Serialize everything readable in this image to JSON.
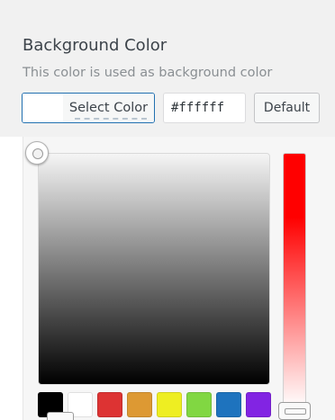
{
  "control": {
    "title": "Background Color",
    "description": "This color is used as background color",
    "select_label": "Select Color",
    "hex_value": "#ffffff",
    "default_label": "Default",
    "current_color": "#ffffff"
  },
  "picker": {
    "hue_gradient_top": "#ff0000",
    "hue_gradient_bottom": "#ffffff",
    "palette": [
      {
        "name": "black",
        "color": "#000000"
      },
      {
        "name": "white",
        "color": "#ffffff"
      },
      {
        "name": "red",
        "color": "#dd3333"
      },
      {
        "name": "orange",
        "color": "#dd9933"
      },
      {
        "name": "yellow",
        "color": "#eeee22"
      },
      {
        "name": "green",
        "color": "#81d742"
      },
      {
        "name": "blue",
        "color": "#1e73be"
      },
      {
        "name": "purple",
        "color": "#8224e3"
      }
    ]
  }
}
